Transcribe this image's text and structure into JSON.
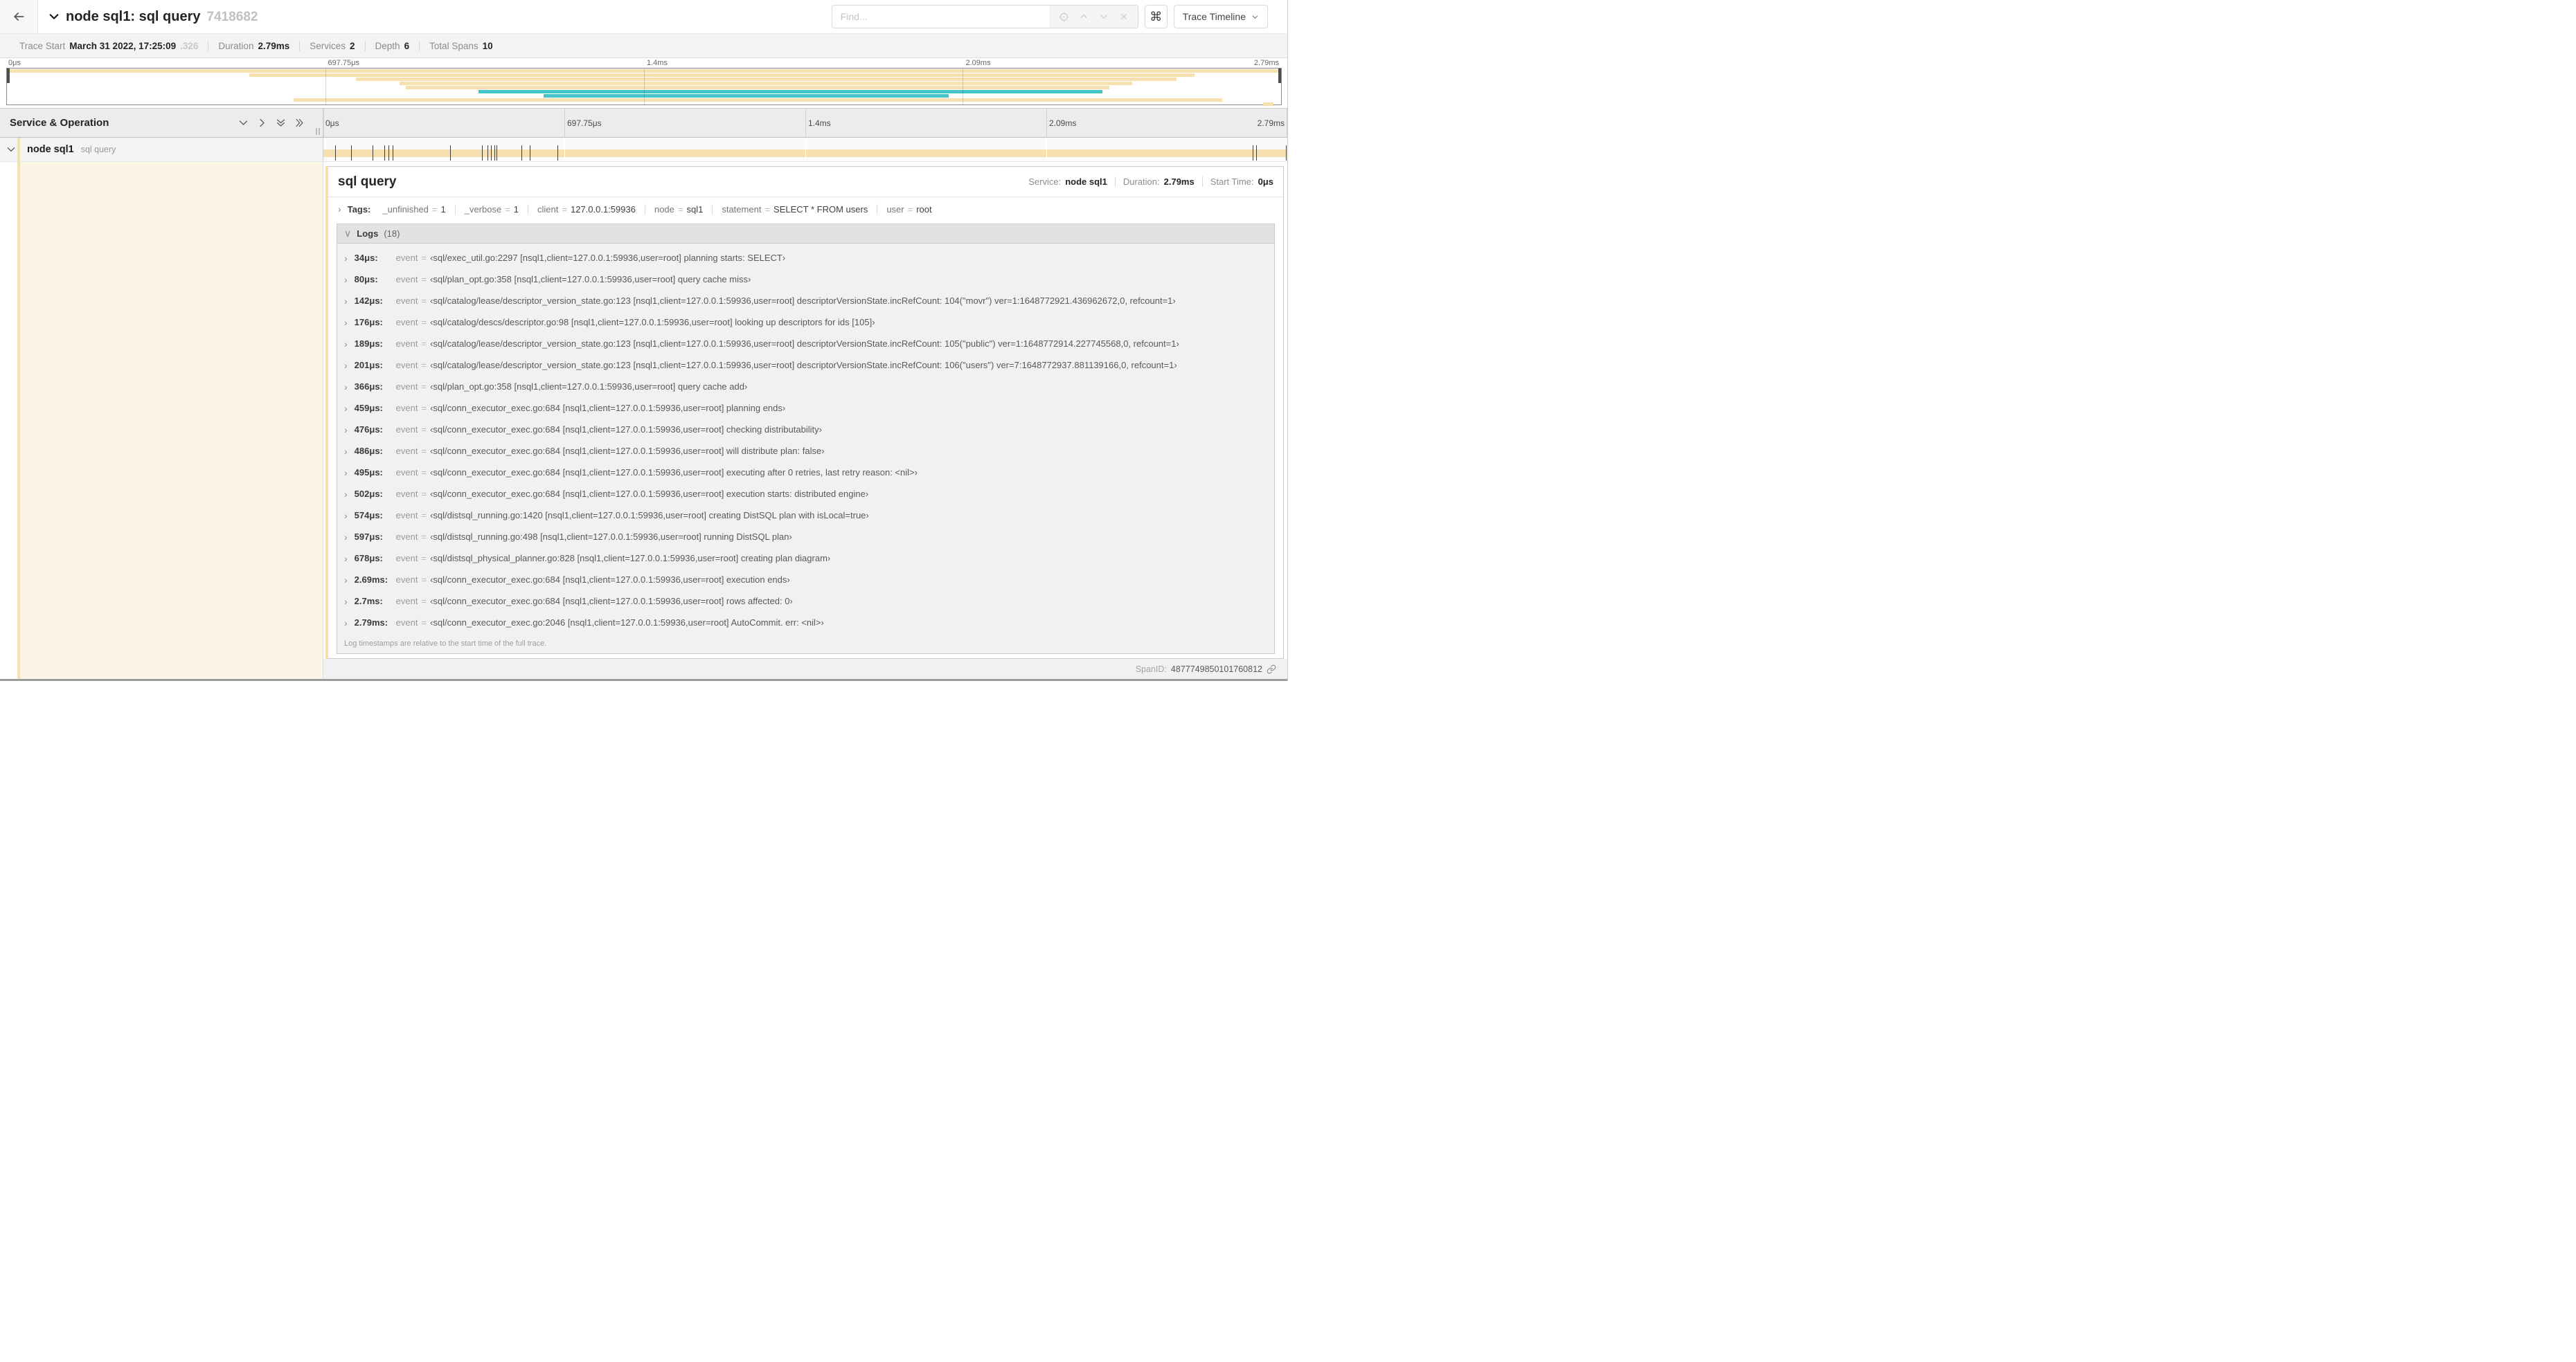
{
  "colors": {
    "tan": "#F7E0B0",
    "teal": "#46C5C6",
    "cream": "#FCF5E5"
  },
  "header": {
    "title": "node sql1: sql query",
    "trace_id_short": "7418682",
    "find_placeholder": "Find...",
    "shortcut_icon": "⌘",
    "view_selector": "Trace Timeline"
  },
  "trace_meta": {
    "items": [
      {
        "label": "Trace Start",
        "value": "March 31 2022, 17:25:09",
        "suffix": ".326"
      },
      {
        "label": "Duration",
        "value": "2.79ms"
      },
      {
        "label": "Services",
        "value": "2"
      },
      {
        "label": "Depth",
        "value": "6"
      },
      {
        "label": "Total Spans",
        "value": "10"
      }
    ]
  },
  "minimap": {
    "ticks": [
      "0μs",
      "697.75μs",
      "1.4ms",
      "2.09ms",
      "2.79ms"
    ],
    "spans": [
      {
        "start": 0,
        "end": 100,
        "color": "tan"
      },
      {
        "start": 19,
        "end": 93.2,
        "color": "tan"
      },
      {
        "start": 27.4,
        "end": 91.8,
        "color": "tan"
      },
      {
        "start": 30.8,
        "end": 88.3,
        "color": "tan"
      },
      {
        "start": 31.3,
        "end": 86.5,
        "color": "tan"
      },
      {
        "start": 37,
        "end": 86,
        "color": "teal"
      },
      {
        "start": 42.1,
        "end": 73.9,
        "color": "teal"
      },
      {
        "start": 22.5,
        "end": 95.4,
        "color": "tan"
      },
      {
        "start": 98.6,
        "end": 99.4,
        "color": "tan"
      }
    ]
  },
  "timeline": {
    "left_header": "Service & Operation",
    "ticks": [
      "0μs",
      "697.75μs",
      "1.4ms",
      "2.09ms",
      "2.79ms"
    ],
    "span_row": {
      "service": "node sql1",
      "operation": "sql query"
    }
  },
  "icons": {
    "collapsed_twisty": "›",
    "expanded_twisty": "∨"
  },
  "detail": {
    "title": "sql query",
    "meta": [
      {
        "label": "Service:",
        "value": "node sql1"
      },
      {
        "label": "Duration:",
        "value": "2.79ms"
      },
      {
        "label": "Start Time:",
        "value": "0μs"
      }
    ],
    "tags_label": "Tags:",
    "tags": [
      {
        "key": "_unfinished",
        "value": "1"
      },
      {
        "key": "_verbose",
        "value": "1"
      },
      {
        "key": "client",
        "value": "127.0.0.1:59936"
      },
      {
        "key": "node",
        "value": "sql1"
      },
      {
        "key": "statement",
        "value": "SELECT * FROM users"
      },
      {
        "key": "user",
        "value": "root"
      }
    ],
    "logs_label": "Logs",
    "logs_count": "(18)",
    "logs": [
      {
        "time": "34μs:",
        "pct": 1.22,
        "key": "event",
        "value": "‹sql/exec_util.go:2297 [nsql1,client=127.0.0.1:59936,user=root] planning starts: SELECT›"
      },
      {
        "time": "80μs:",
        "pct": 2.87,
        "key": "event",
        "value": "‹sql/plan_opt.go:358 [nsql1,client=127.0.0.1:59936,user=root] query cache miss›"
      },
      {
        "time": "142μs:",
        "pct": 5.09,
        "key": "event",
        "value": "‹sql/catalog/lease/descriptor_version_state.go:123 [nsql1,client=127.0.0.1:59936,user=root] descriptorVersionState.incRefCount: 104(\"movr\") ver=1:1648772921.436962672,0, refcount=1›"
      },
      {
        "time": "176μs:",
        "pct": 6.31,
        "key": "event",
        "value": "‹sql/catalog/descs/descriptor.go:98 [nsql1,client=127.0.0.1:59936,user=root] looking up descriptors for ids [105]›"
      },
      {
        "time": "189μs:",
        "pct": 6.77,
        "key": "event",
        "value": "‹sql/catalog/lease/descriptor_version_state.go:123 [nsql1,client=127.0.0.1:59936,user=root] descriptorVersionState.incRefCount: 105(\"public\") ver=1:1648772914.227745568,0, refcount=1›"
      },
      {
        "time": "201μs:",
        "pct": 7.2,
        "key": "event",
        "value": "‹sql/catalog/lease/descriptor_version_state.go:123 [nsql1,client=127.0.0.1:59936,user=root] descriptorVersionState.incRefCount: 106(\"users\") ver=7:1648772937.881139166,0, refcount=1›"
      },
      {
        "time": "366μs:",
        "pct": 13.12,
        "key": "event",
        "value": "‹sql/plan_opt.go:358 [nsql1,client=127.0.0.1:59936,user=root] query cache add›"
      },
      {
        "time": "459μs:",
        "pct": 16.45,
        "key": "event",
        "value": "‹sql/conn_executor_exec.go:684 [nsql1,client=127.0.0.1:59936,user=root] planning ends›"
      },
      {
        "time": "476μs:",
        "pct": 17.06,
        "key": "event",
        "value": "‹sql/conn_executor_exec.go:684 [nsql1,client=127.0.0.1:59936,user=root] checking distributability›"
      },
      {
        "time": "486μs:",
        "pct": 17.42,
        "key": "event",
        "value": "‹sql/conn_executor_exec.go:684 [nsql1,client=127.0.0.1:59936,user=root] will distribute plan: false›"
      },
      {
        "time": "495μs:",
        "pct": 17.74,
        "key": "event",
        "value": "‹sql/conn_executor_exec.go:684 [nsql1,client=127.0.0.1:59936,user=root] executing after 0 retries, last retry reason: <nil>›"
      },
      {
        "time": "502μs:",
        "pct": 17.99,
        "key": "event",
        "value": "‹sql/conn_executor_exec.go:684 [nsql1,client=127.0.0.1:59936,user=root] execution starts: distributed engine›"
      },
      {
        "time": "574μs:",
        "pct": 20.57,
        "key": "event",
        "value": "‹sql/distsql_running.go:1420 [nsql1,client=127.0.0.1:59936,user=root] creating DistSQL plan with isLocal=true›"
      },
      {
        "time": "597μs:",
        "pct": 21.4,
        "key": "event",
        "value": "‹sql/distsql_running.go:498 [nsql1,client=127.0.0.1:59936,user=root] running DistSQL plan›"
      },
      {
        "time": "678μs:",
        "pct": 24.3,
        "key": "event",
        "value": "‹sql/distsql_physical_planner.go:828 [nsql1,client=127.0.0.1:59936,user=root] creating plan diagram›"
      },
      {
        "time": "2.69ms:",
        "pct": 96.42,
        "key": "event",
        "value": "‹sql/conn_executor_exec.go:684 [nsql1,client=127.0.0.1:59936,user=root] execution ends›"
      },
      {
        "time": "2.7ms:",
        "pct": 96.77,
        "key": "event",
        "value": "‹sql/conn_executor_exec.go:684 [nsql1,client=127.0.0.1:59936,user=root] rows affected: 0›"
      },
      {
        "time": "2.79ms:",
        "pct": 99.85,
        "key": "event",
        "value": "‹sql/conn_executor_exec.go:2046 [nsql1,client=127.0.0.1:59936,user=root] AutoCommit. err: <nil>›"
      }
    ],
    "footer_note": "Log timestamps are relative to the start time of the full trace.",
    "span_id_label": "SpanID:",
    "span_id": "4877749850101760812"
  }
}
